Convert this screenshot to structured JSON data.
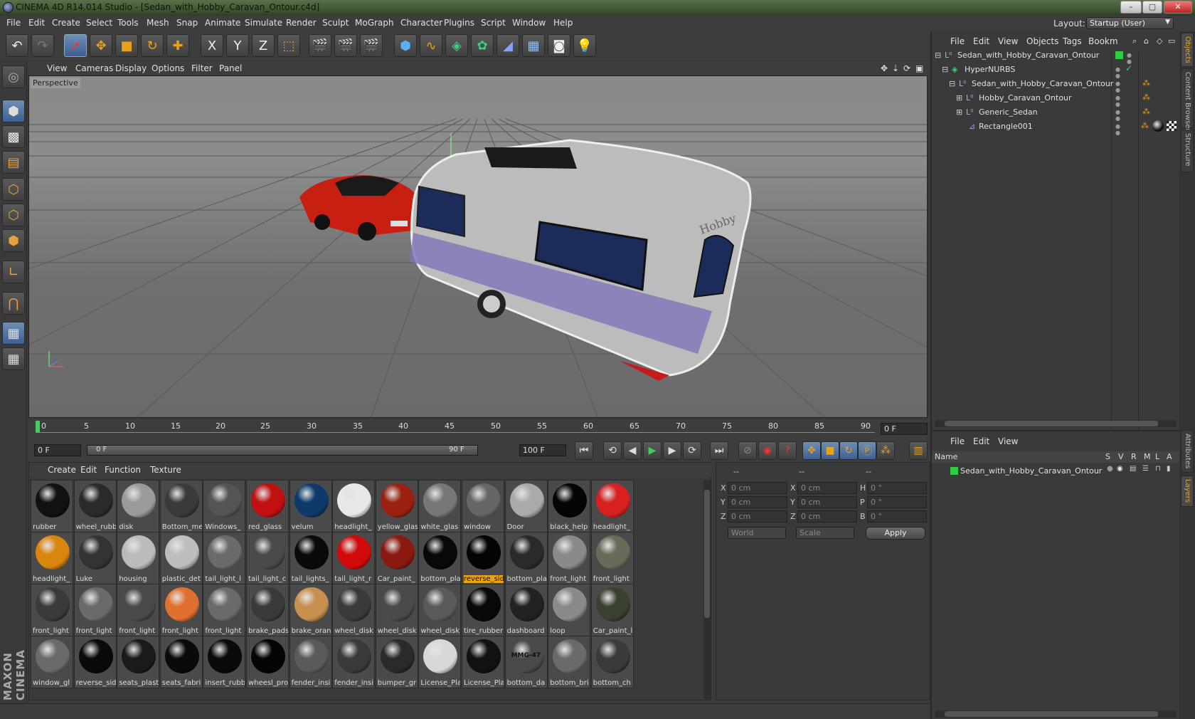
{
  "window": {
    "title": "CINEMA 4D R14.014 Studio - [Sedan_with_Hobby_Caravan_Ontour.c4d]",
    "minimize": "–",
    "maximize": "▢",
    "close": "✕"
  },
  "menubar": {
    "items": [
      "File",
      "Edit",
      "Create",
      "Select",
      "Tools",
      "Mesh",
      "Snap",
      "Animate",
      "Simulate",
      "Render",
      "Sculpt",
      "MoGraph",
      "Character",
      "Plugins",
      "Script",
      "Window",
      "Help"
    ]
  },
  "layout": {
    "label": "Layout:",
    "value": "Startup (User)"
  },
  "toolbar": {
    "axis_x": "X",
    "axis_y": "Y",
    "axis_z": "Z"
  },
  "viewport": {
    "menu": [
      "View",
      "Cameras",
      "Display",
      "Options",
      "Filter",
      "Panel"
    ],
    "label": "Perspective",
    "trailer_brand": "Hobby"
  },
  "timeline": {
    "ticks": [
      "0",
      "5",
      "10",
      "15",
      "20",
      "25",
      "30",
      "35",
      "40",
      "45",
      "50",
      "55",
      "60",
      "65",
      "70",
      "75",
      "80",
      "85",
      "90"
    ],
    "current_frame": "0 F"
  },
  "transport": {
    "start": "0 F",
    "range_start": "0 F",
    "range_end": "90 F",
    "end": "100 F"
  },
  "material_panel": {
    "menu": [
      "Create",
      "Edit",
      "Function",
      "Texture"
    ],
    "materials": [
      {
        "name": "rubber",
        "color": "#111111"
      },
      {
        "name": "wheel_rubb",
        "color": "#2a2a2a"
      },
      {
        "name": "disk",
        "color": "#9a9a9a"
      },
      {
        "name": "Bottom_me",
        "color": "#3a3a3a"
      },
      {
        "name": "Windows_",
        "color": "#555555"
      },
      {
        "name": "red_glass",
        "color": "#c01010"
      },
      {
        "name": "velum",
        "color": "#0e3a6a"
      },
      {
        "name": "headlight_",
        "color": "#e8e8e8"
      },
      {
        "name": "yellow_glas",
        "color": "#9a2010"
      },
      {
        "name": "white_glas",
        "color": "#777777"
      },
      {
        "name": "window",
        "color": "#666666"
      },
      {
        "name": "Door",
        "color": "#aaaaaa"
      },
      {
        "name": "black_help",
        "color": "#050505"
      },
      {
        "name": "headlight_",
        "color": "#d82020"
      },
      {
        "name": "headlight_",
        "color": "#d8860e"
      },
      {
        "name": "Luke",
        "color": "#333333"
      },
      {
        "name": "housing",
        "color": "#bbbbbb"
      },
      {
        "name": "plastic_det",
        "color": "#bdbdbd"
      },
      {
        "name": "tail_light_l",
        "color": "#6a6a6a"
      },
      {
        "name": "tail_light_c",
        "color": "#4a4a4a"
      },
      {
        "name": "tail_lights_",
        "color": "#0a0a0a"
      },
      {
        "name": "tail_light_r",
        "color": "#d00a0a"
      },
      {
        "name": "Car_paint_",
        "color": "#8a1a10"
      },
      {
        "name": "bottom_pla",
        "color": "#080808"
      },
      {
        "name": "reverse_sid",
        "color": "#050505"
      },
      {
        "name": "bottom_pla",
        "color": "#2a2a2a"
      },
      {
        "name": "front_light",
        "color": "#8a8a8a"
      },
      {
        "name": "front_light",
        "color": "#6a6a5a"
      },
      {
        "name": "front_light",
        "color": "#3a3a3a"
      },
      {
        "name": "front_light",
        "color": "#6a6a6a"
      },
      {
        "name": "front_light",
        "color": "#4a4a4a"
      },
      {
        "name": "front_light",
        "color": "#e07030"
      },
      {
        "name": "front_light",
        "color": "#6a6a6a"
      },
      {
        "name": "brake_pads",
        "color": "#3a3a3a"
      },
      {
        "name": "brake_oran",
        "color": "#c89050"
      },
      {
        "name": "wheel_disk",
        "color": "#3a3a3a"
      },
      {
        "name": "wheel_disk",
        "color": "#4a4a4a"
      },
      {
        "name": "wheel_disk",
        "color": "#5a5a5a"
      },
      {
        "name": "tire_rubber",
        "color": "#080808"
      },
      {
        "name": "dashboard",
        "color": "#222222"
      },
      {
        "name": "loop",
        "color": "#8a8a8a"
      },
      {
        "name": "Car_paint_l",
        "color": "#3a4030"
      },
      {
        "name": "window_gl",
        "color": "#6a6a6a"
      },
      {
        "name": "reverse_sid",
        "color": "#0a0a0a"
      },
      {
        "name": "seats_plast",
        "color": "#1a1a1a"
      },
      {
        "name": "seats_fabri",
        "color": "#0a0a0a"
      },
      {
        "name": "insert_rubb",
        "color": "#0a0a0a"
      },
      {
        "name": "wheesl_pro",
        "color": "#050505"
      },
      {
        "name": "fender_insi",
        "color": "#5a5a5a"
      },
      {
        "name": "fender_insi",
        "color": "#3a3a3a"
      },
      {
        "name": "bumper_gr",
        "color": "#2a2a2a"
      },
      {
        "name": "License_Pla",
        "color": "#d8d8d8"
      },
      {
        "name": "License_Pla",
        "color": "#111111"
      },
      {
        "name": "bottom_da",
        "color": "#4a4a4a"
      },
      {
        "name": "bottom_bri",
        "color": "#6a6a6a"
      },
      {
        "name": "bottom_ch",
        "color": "#3a3a3a"
      }
    ],
    "highlighted_index": 24,
    "plate_text": "MMG-47"
  },
  "attributes": {
    "header": [
      "--",
      "--",
      "--"
    ],
    "rows": [
      {
        "a": "X",
        "av": "0 cm",
        "b": "X",
        "bv": "0 cm",
        "c": "H",
        "cv": "0 °"
      },
      {
        "a": "Y",
        "av": "0 cm",
        "b": "Y",
        "bv": "0 cm",
        "c": "P",
        "cv": "0 °"
      },
      {
        "a": "Z",
        "av": "0 cm",
        "b": "Z",
        "bv": "0 cm",
        "c": "B",
        "cv": "0 °"
      }
    ],
    "coord_mode": "World",
    "size_mode": "Scale",
    "apply": "Apply"
  },
  "objects_panel": {
    "menu": [
      "File",
      "Edit",
      "View",
      "Objects",
      "Tags",
      "Bookm"
    ],
    "tree": [
      {
        "name": "Sedan_with_Hobby_Caravan_Ontour",
        "depth": 0,
        "icon": "null-icon"
      },
      {
        "name": "HyperNURBS",
        "depth": 1,
        "icon": "hypernurbs-icon"
      },
      {
        "name": "Sedan_with_Hobby_Caravan_Ontour",
        "depth": 2,
        "icon": "null-icon"
      },
      {
        "name": "Hobby_Caravan_Ontour",
        "depth": 3,
        "icon": "null-icon"
      },
      {
        "name": "Generic_Sedan",
        "depth": 3,
        "icon": "null-icon"
      },
      {
        "name": "Rectangle001",
        "depth": 3,
        "icon": "spline-icon"
      }
    ]
  },
  "layers_panel": {
    "menu": [
      "File",
      "Edit",
      "View"
    ],
    "columns": {
      "name": "Name",
      "s": "S",
      "v": "V",
      "r": "R",
      "m": "M",
      "l": "L",
      "a": "A"
    },
    "rows": [
      {
        "name": "Sedan_with_Hobby_Caravan_Ontour",
        "color": "#2ecc40"
      }
    ]
  },
  "side_tabs": [
    "Objects",
    "Content Browser",
    "Structure",
    "Attributes",
    "Layers"
  ],
  "branding": "MAXON CINEMA 4D"
}
